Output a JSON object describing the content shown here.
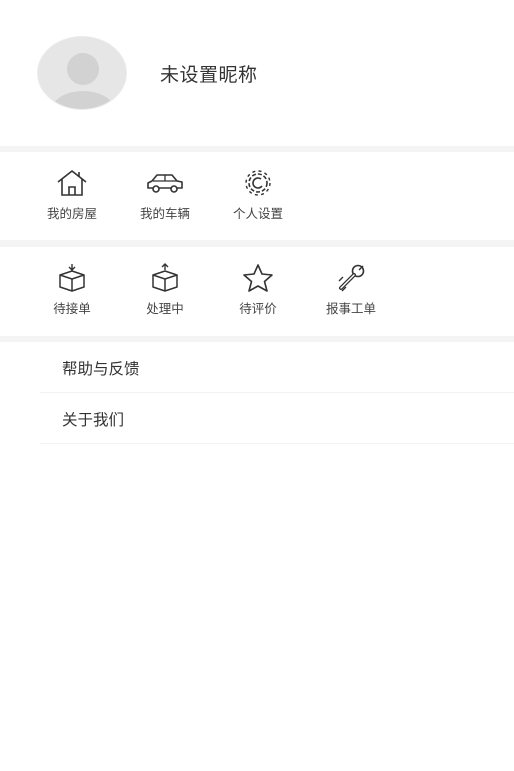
{
  "profile": {
    "nickname": "未设置昵称"
  },
  "services": [
    {
      "label": "我的房屋",
      "icon": "house-icon"
    },
    {
      "label": "我的车辆",
      "icon": "car-icon"
    },
    {
      "label": "个人设置",
      "icon": "gear-icon"
    }
  ],
  "orders": [
    {
      "label": "待接单",
      "icon": "box-in-icon"
    },
    {
      "label": "处理中",
      "icon": "box-out-icon"
    },
    {
      "label": "待评价",
      "icon": "star-icon"
    },
    {
      "label": "报事工单",
      "icon": "wrench-icon"
    }
  ],
  "menu": [
    {
      "label": "帮助与反馈"
    },
    {
      "label": "关于我们"
    }
  ],
  "colors": {
    "background": "#ffffff",
    "separator": "#f4f4f4",
    "icon_stroke": "#333333",
    "avatar": "#e4e4e4"
  }
}
